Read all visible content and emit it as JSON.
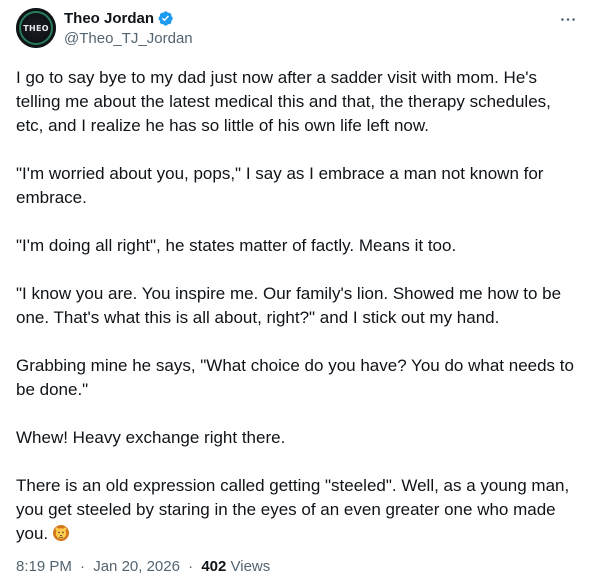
{
  "author": {
    "avatar_text": "THEO",
    "display_name": "Theo Jordan",
    "handle": "@Theo_TJ_Jordan",
    "verified": true,
    "verified_color": "#1d9bf0"
  },
  "more_menu": {
    "icon": "more-horizontal-icon"
  },
  "tweet": {
    "paragraphs": [
      "I go to say bye to my dad just now after a sadder visit with mom. He's telling me about the latest medical this and that, the therapy schedules, etc, and I realize he has so little of his own life left now.",
      "\"I'm worried about you, pops,\" I say as I embrace a man not known for embrace.",
      "\"I'm doing all right\", he states matter of factly. Means it too.",
      "\"I know you are. You inspire me. Our family's lion. Showed me how to be one. That's what this is all about, right?\" and I stick out my hand.",
      "Grabbing mine he says, \"What choice do you have? You do what needs to be done.\"",
      "Whew! Heavy exchange right there.",
      "There is an old expression called getting \"steeled\". Well, as a young man, you get steeled by staring in the eyes of an even greater one who made you."
    ],
    "emoji": "lion-face-icon"
  },
  "meta": {
    "time": "8:19 PM",
    "date": "Jan 20, 2026",
    "separator": "·",
    "views_count": "402",
    "views_label": "Views"
  },
  "colors": {
    "text": "#0f1419",
    "secondary": "#536471",
    "verified": "#1d9bf0"
  }
}
